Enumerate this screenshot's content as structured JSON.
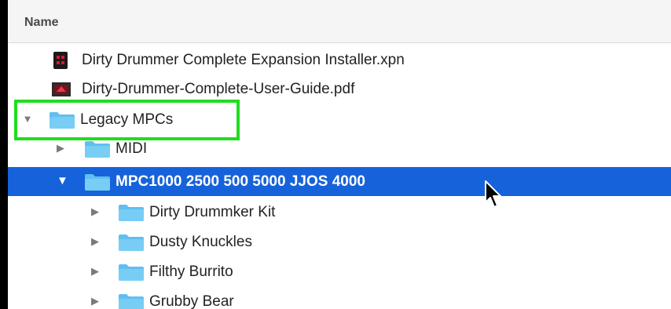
{
  "header": {
    "name_label": "Name"
  },
  "rows": [
    {
      "label": "Dirty Drummer Complete Expansion Installer.xpn"
    },
    {
      "label": "Dirty-Drummer-Complete-User-Guide.pdf"
    },
    {
      "label": "Legacy MPCs"
    },
    {
      "label": "MIDI"
    },
    {
      "label": "MPC1000 2500 500 5000 JJOS 4000"
    },
    {
      "label": "Dirty Drummker Kit"
    },
    {
      "label": "Dusty Knuckles"
    },
    {
      "label": "Filthy Burrito"
    },
    {
      "label": "Grubby Bear"
    }
  ],
  "glyphs": {
    "expanded": "▼",
    "collapsed": "▶"
  },
  "colors": {
    "selection": "#1662da",
    "highlight_box": "#1fdd1f",
    "folder_fill": "#5fbff0"
  }
}
